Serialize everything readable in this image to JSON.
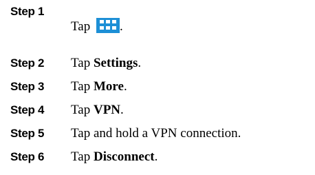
{
  "steps": [
    {
      "label": "Step 1",
      "parts": [
        "Tap ",
        "",
        "."
      ],
      "icon": "apps-grid-icon"
    },
    {
      "label": "Step 2",
      "parts": [
        "Tap ",
        "Settings",
        "."
      ]
    },
    {
      "label": "Step 3",
      "parts": [
        "Tap ",
        "More",
        "."
      ]
    },
    {
      "label": "Step 4",
      "parts": [
        "Tap ",
        "VPN",
        "."
      ]
    },
    {
      "label": "Step 5",
      "parts": [
        "Tap and hold a VPN connection.",
        "",
        ""
      ]
    },
    {
      "label": "Step 6",
      "parts": [
        "Tap ",
        "Disconnect",
        "."
      ]
    }
  ],
  "icon_color": "#1d8fd6"
}
